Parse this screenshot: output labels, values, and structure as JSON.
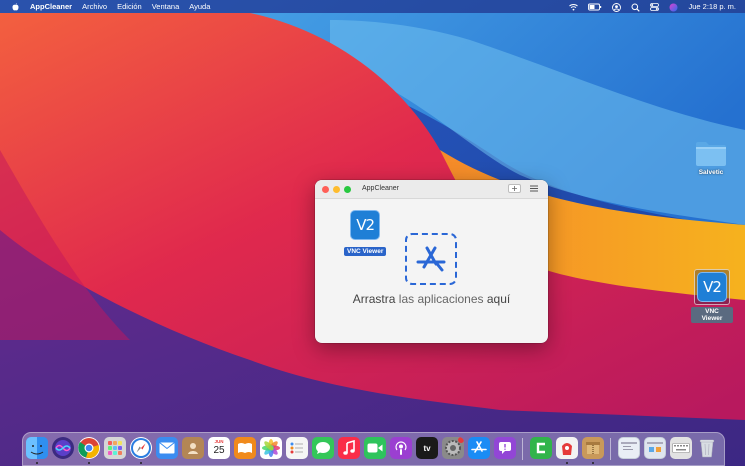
{
  "menubar": {
    "app_name": "AppCleaner",
    "menus": [
      "Archivo",
      "Edición",
      "Ventana",
      "Ayuda"
    ],
    "clock": "Jue 2:18 p. m.",
    "status_icons": [
      "wifi-icon",
      "battery-icon",
      "user-icon",
      "search-icon",
      "control-center-icon",
      "siri-icon"
    ]
  },
  "desktop": {
    "folder_label": "Salvetic",
    "vnc_icon_text": "V2",
    "vnc_label": "VNC Viewer"
  },
  "window": {
    "title": "AppCleaner",
    "drag_item_label": "VNC Viewer",
    "drag_item_icon_text": "V2",
    "drop_text_1": "Arrastra",
    "drop_text_2": "las aplicaciones",
    "drop_text_3": "aquí"
  },
  "dock": {
    "calendar_month": "JUN",
    "calendar_day": "25",
    "tv_label": "tv",
    "items": [
      {
        "name": "finder",
        "color": "#2f8ff0"
      },
      {
        "name": "siri",
        "color": "#5a3fc9"
      },
      {
        "name": "chrome",
        "color": "#e8e8e8"
      },
      {
        "name": "launchpad",
        "color": "#d6d6d6"
      },
      {
        "name": "safari",
        "color": "#2a7de0"
      },
      {
        "name": "mail",
        "color": "#3b8cf0"
      },
      {
        "name": "contacts",
        "color": "#b38655"
      },
      {
        "name": "calendar",
        "color": "#ffffff"
      },
      {
        "name": "books",
        "color": "#f08a1c"
      },
      {
        "name": "photos",
        "color": "#ffffff"
      },
      {
        "name": "reminders",
        "color": "#f5f5f5"
      },
      {
        "name": "messages",
        "color": "#34c759"
      },
      {
        "name": "music",
        "color": "#fa2d48"
      },
      {
        "name": "facetime",
        "color": "#2ec45c"
      },
      {
        "name": "podcasts",
        "color": "#9b3fd1"
      },
      {
        "name": "tv",
        "color": "#1a1a1a"
      },
      {
        "name": "system-preferences",
        "color": "#8a8a8a"
      },
      {
        "name": "app-store",
        "color": "#1a8cf5"
      },
      {
        "name": "feedback",
        "color": "#9246d6"
      },
      {
        "name": "camtasia",
        "color": "#31b44b"
      },
      {
        "name": "appcleaner-dock",
        "color": "#e53a3a"
      },
      {
        "name": "archive-utility",
        "color": "#c9995a"
      },
      {
        "name": "preview-window-1",
        "color": "#e9eef5"
      },
      {
        "name": "preview-window-2",
        "color": "#dfe6ef"
      },
      {
        "name": "keyboard-viewer",
        "color": "#e2e2e2"
      },
      {
        "name": "trash",
        "color": "#d0d4d9"
      }
    ]
  }
}
